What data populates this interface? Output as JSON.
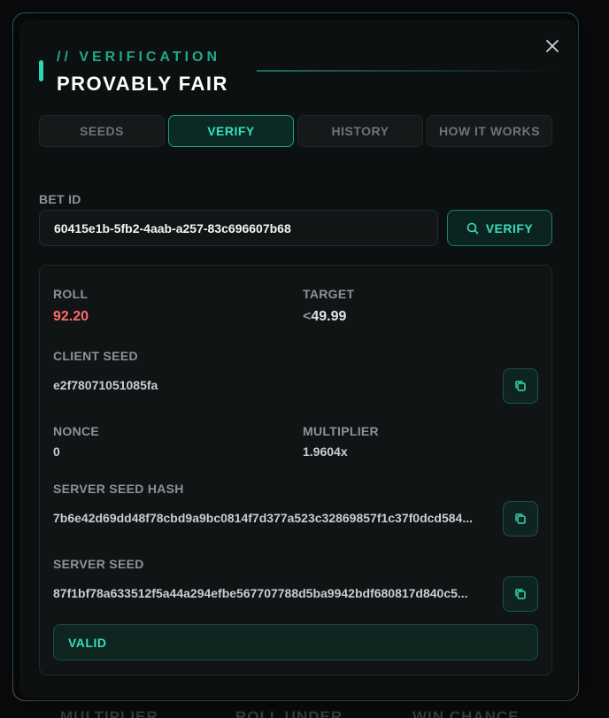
{
  "modal": {
    "kicker": "// VERIFICATION",
    "title": "PROVABLY FAIR",
    "close_icon": "close-icon"
  },
  "tabs": [
    {
      "label": "SEEDS",
      "active": false
    },
    {
      "label": "VERIFY",
      "active": true
    },
    {
      "label": "HISTORY",
      "active": false
    },
    {
      "label": "HOW IT WORKS",
      "active": false
    }
  ],
  "bet_id": {
    "label": "BET ID",
    "value": "60415e1b-5fb2-4aab-a257-83c696607b68"
  },
  "verify_button": {
    "label": "VERIFY",
    "icon": "search-icon"
  },
  "result": {
    "roll_label": "ROLL",
    "roll_value": "92.20",
    "target_label": "TARGET",
    "target_prefix": "<",
    "target_value": "49.99",
    "client_seed_label": "CLIENT SEED",
    "client_seed_value": "e2f78071051085fa",
    "nonce_label": "NONCE",
    "nonce_value": "0",
    "multiplier_label": "MULTIPLIER",
    "multiplier_value": "1.9604x",
    "server_seed_hash_label": "SERVER SEED HASH",
    "server_seed_hash_value": "7b6e42d69dd48f78cbd9a9bc0814f7d377a523c32869857f1c37f0dcd584...",
    "server_seed_label": "SERVER SEED",
    "server_seed_value": "87f1bf78a633512f5a44a294efbe567707788d5ba9942bdf680817d840c5...",
    "status": "VALID"
  },
  "background_labels": [
    "MULTIPLIER",
    "ROLL UNDER",
    "WIN CHANCE"
  ],
  "colors": {
    "accent": "#33e0bb",
    "roll_loss": "#ff6b6b",
    "panel": "#0d1011"
  }
}
